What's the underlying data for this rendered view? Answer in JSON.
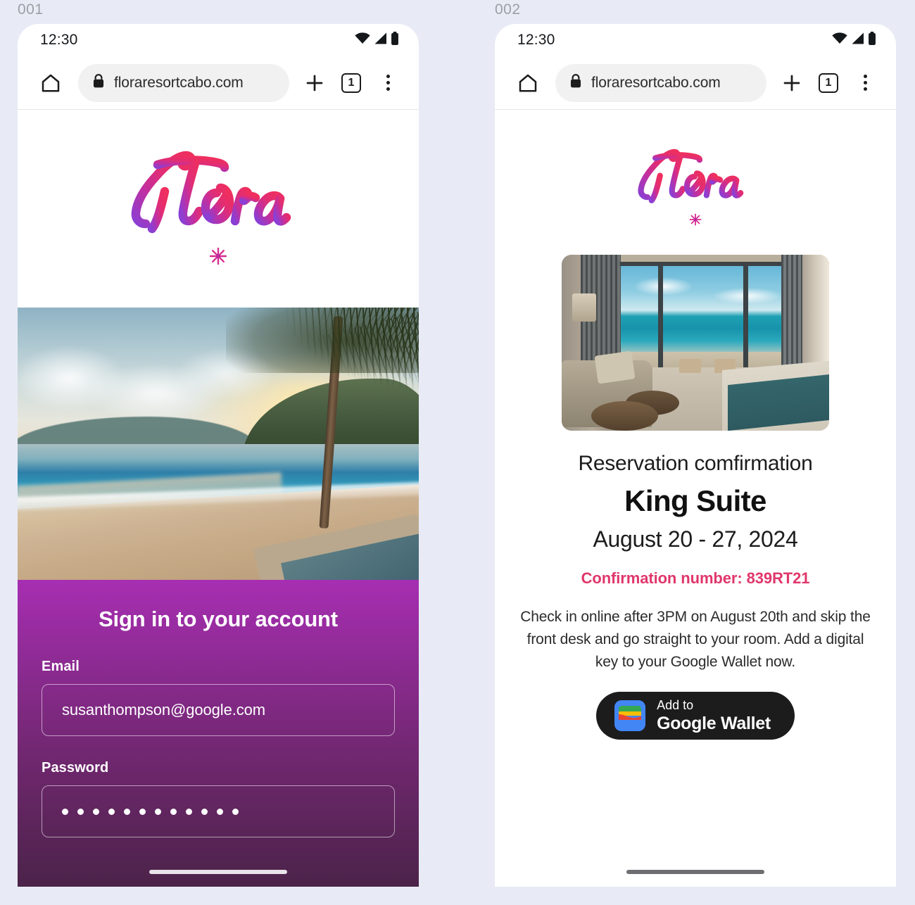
{
  "page": {
    "background_color": "#e8ebf5",
    "frames": [
      {
        "label": "001"
      },
      {
        "label": "002"
      }
    ]
  },
  "status_bar": {
    "time": "12:30",
    "icons": [
      "wifi-icon",
      "cell-signal-icon",
      "battery-icon"
    ]
  },
  "browser": {
    "home_icon": "home-icon",
    "lock_icon": "lock-icon",
    "url": "floraresortcabo.com",
    "new_tab_icon": "plus-icon",
    "tab_count": "1",
    "menu_icon": "kebab-menu-icon"
  },
  "brand": {
    "wordmark": "Flora",
    "flower_mark": "asterisk-flower-icon",
    "gradient_start": "#8b3fd4",
    "gradient_mid": "#d92d7a",
    "gradient_end": "#e8316a"
  },
  "signin": {
    "hero_image_alt": "beach-sunset-photo",
    "title": "Sign in to your account",
    "email": {
      "label": "Email",
      "value": "susanthompson@google.com",
      "placeholder": "Email"
    },
    "password": {
      "label": "Password",
      "masked_value": "••••••••••••",
      "dot_count": 12,
      "placeholder": "Password"
    },
    "panel_gradient_top": "#a72eb2",
    "panel_gradient_bottom": "#4b2349"
  },
  "confirmation": {
    "room_image_alt": "king-suite-ocean-view-photo",
    "heading": "Reservation comfirmation",
    "room": "King Suite",
    "dates": "August 20 - 27, 2024",
    "confirmation_line": "Confirmation number: 839RT21",
    "confirmation_color": "#e0376b",
    "note": "Check in online after 3PM on August 20th and skip the front desk and go straight to your room. Add a digital key to your Google Wallet now.",
    "wallet_button": {
      "icon": "google-wallet-icon",
      "line1": "Add to",
      "line2": "Google Wallet",
      "background": "#1c1c1c"
    }
  }
}
